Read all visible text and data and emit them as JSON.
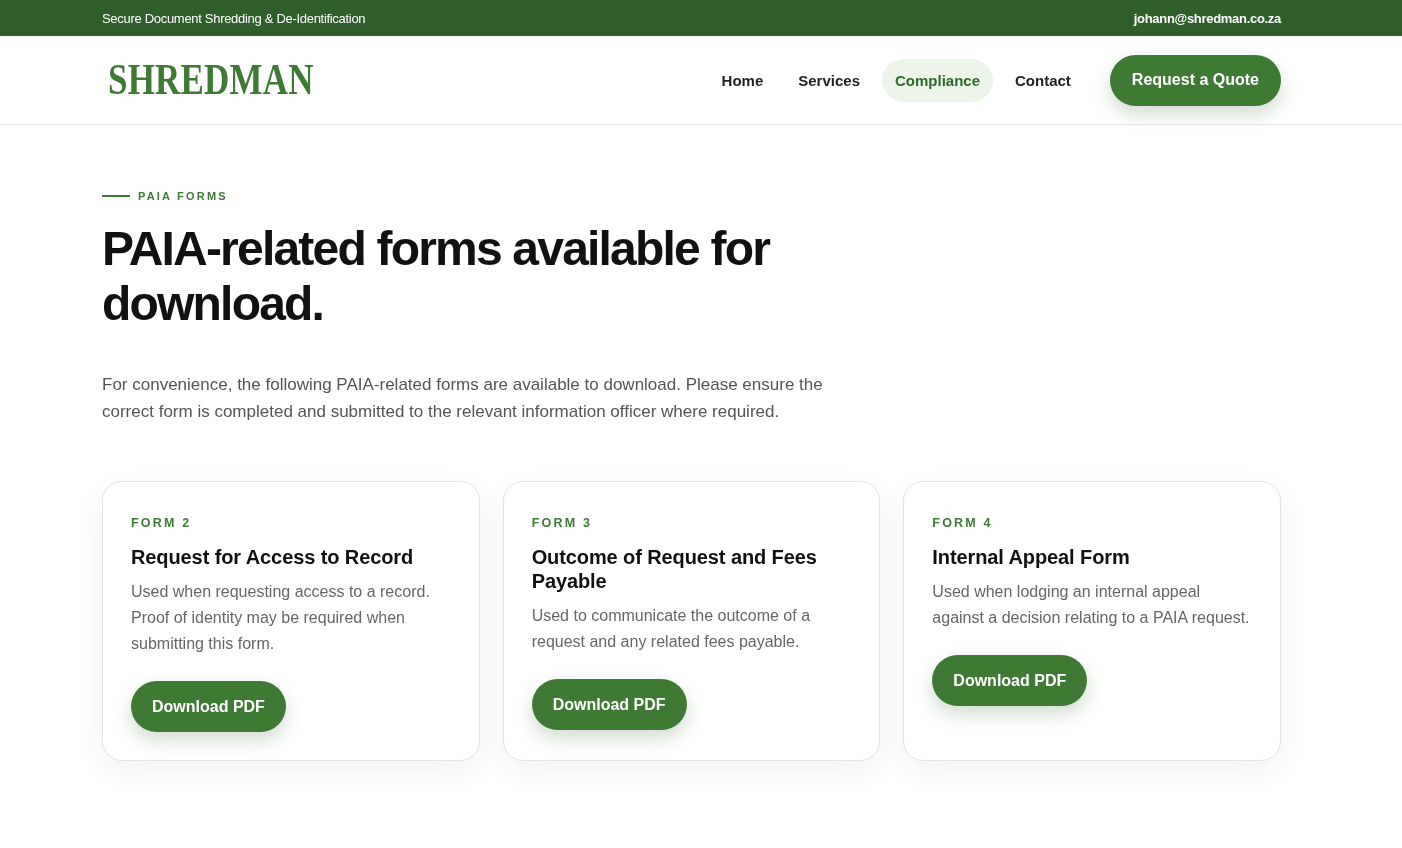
{
  "top_bar": {
    "tagline": "Secure Document Shredding & De-Identification",
    "email": "johann@shredman.co.za"
  },
  "header": {
    "logo": "SHREDMAN",
    "nav": [
      {
        "label": "Home",
        "selected": false
      },
      {
        "label": "Services",
        "selected": false
      },
      {
        "label": "Compliance",
        "selected": true
      },
      {
        "label": "Contact",
        "selected": false
      }
    ],
    "cta": "Request a Quote"
  },
  "intro": {
    "eyebrow": "PAIA FORMS",
    "heading": "PAIA-related forms available for download.",
    "text": "For convenience, the following PAIA-related forms are available to download. Please ensure the correct form is completed and submitted to the relevant information officer where required."
  },
  "forms": [
    {
      "label": "FORM 2",
      "title": "Request for Access to Record",
      "description": "Used when requesting access to a record. Proof of identity may be required when submitting this form.",
      "button": "Download PDF"
    },
    {
      "label": "FORM 3",
      "title": "Outcome of Request and Fees Payable",
      "description": "Used to communicate the outcome of a request and any related fees payable.",
      "button": "Download PDF"
    },
    {
      "label": "FORM 4",
      "title": "Internal Appeal Form",
      "description": "Used when lodging an internal appeal against a decision relating to a PAIA request.",
      "button": "Download PDF"
    }
  ]
}
